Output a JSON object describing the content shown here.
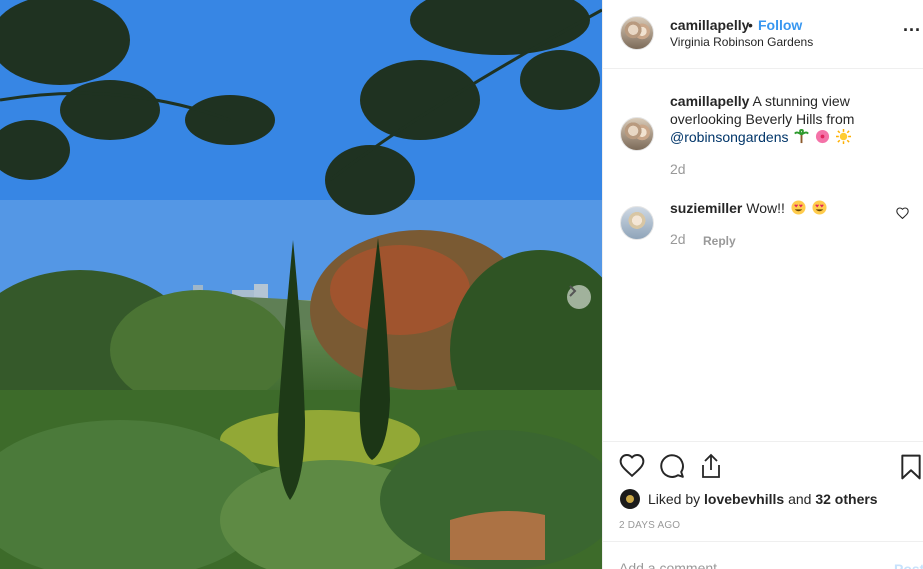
{
  "post": {
    "image_alt": "Garden view with cypress trees and city skyline",
    "carousel_next_icon": "chevron-right-icon"
  },
  "header": {
    "username": "camillapelly",
    "separator": "•",
    "follow_label": "Follow",
    "location": "Virginia Robinson Gardens",
    "more_icon": "more-horizontal-icon",
    "more_label": "..."
  },
  "caption": {
    "username": "camillapelly",
    "text": "A stunning view overlooking Beverly Hills from",
    "mention": "@robinsongardens",
    "emojis": [
      "palm-tree-emoji",
      "hibiscus-emoji",
      "sun-emoji"
    ],
    "time": "2d"
  },
  "comments": [
    {
      "username": "suziemiller",
      "text": "Wow!!",
      "emojis": [
        "heart-eyes-emoji",
        "heart-eyes-emoji"
      ],
      "time": "2d",
      "reply_label": "Reply"
    }
  ],
  "actions": {
    "like_icon": "heart-icon",
    "comment_icon": "comment-icon",
    "share_icon": "share-icon",
    "save_icon": "bookmark-icon"
  },
  "likes": {
    "prefix": "Liked by",
    "liker": "lovebevhills",
    "suffix": "and",
    "others": "32 others"
  },
  "post_date": "2 DAYS AGO",
  "add_comment": {
    "placeholder": "Add a comment…",
    "post_label": "Post"
  },
  "colors": {
    "accent": "#3897f0",
    "mention": "#003569",
    "muted": "#999999",
    "text": "#262626",
    "border": "#efefef"
  }
}
